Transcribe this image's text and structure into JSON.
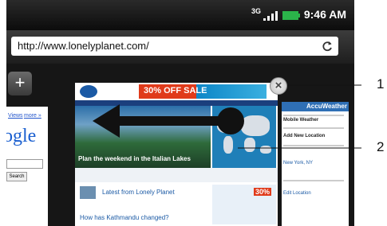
{
  "status": {
    "time": "9:46 AM",
    "network": "3G"
  },
  "browser": {
    "url": "http://www.lonelyplanet.com/"
  },
  "tabs": {
    "add_label": "+",
    "left_page": {
      "link1": "Views",
      "link2": "more »",
      "logo_fragment": "ogle",
      "button": "Search"
    },
    "center_page": {
      "ad_text": "30% OFF SALE",
      "hero_caption": "Plan the weekend in the Italian Lakes",
      "news_title": "Latest from Lonely Planet",
      "story_title": "How has Kathmandu changed?",
      "ad2_text": "30%"
    },
    "right_page": {
      "header": "AccuWeather",
      "line1": "Mobile Weather",
      "line2": "Add New Location",
      "line3": "New York, NY",
      "line4": "Edit Location"
    },
    "close_label": "×"
  },
  "callouts": [
    "1",
    "2"
  ],
  "colors": {
    "accent": "#1b5aa5",
    "ad_red": "#e03a1a"
  }
}
